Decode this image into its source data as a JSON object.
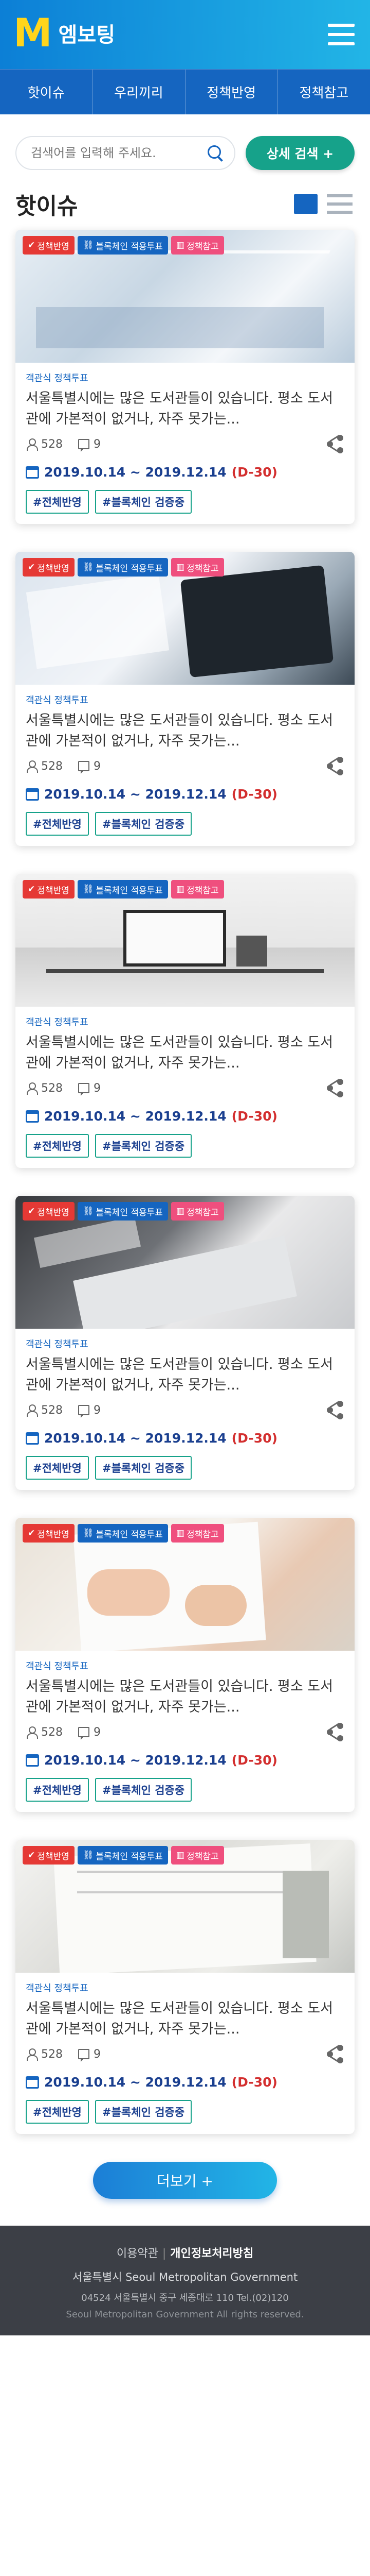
{
  "header": {
    "logo_mark": "M",
    "logo_text": "엠보팅"
  },
  "nav": [
    "핫이슈",
    "우리끼리",
    "정책반영",
    "정책참고"
  ],
  "search": {
    "placeholder": "검색어를 입력해 주세요.",
    "detail_label": "상세 검색 +"
  },
  "section": {
    "title": "핫이슈"
  },
  "cards": [
    {
      "badges": [
        "정책반영",
        "블록체인 적용투표",
        "정책참고"
      ],
      "category": "객관식  정책투표",
      "text": "서울특별시에는 많은 도서관들이 있습니다. 평소 도서관에 가본적이 없거나, 자주 못가는...",
      "views": "528",
      "comments": "9",
      "date": "2019.10.14 ~ 2019.12.14",
      "dday": "(D-30)",
      "tags": [
        "#전체반영",
        "#블록체인 검증중"
      ]
    },
    {
      "badges": [
        "정책반영",
        "블록체인 적용투표",
        "정책참고"
      ],
      "category": "객관식  정책투표",
      "text": "서울특별시에는 많은 도서관들이 있습니다. 평소 도서관에 가본적이 없거나, 자주 못가는...",
      "views": "528",
      "comments": "9",
      "date": "2019.10.14 ~ 2019.12.14",
      "dday": "(D-30)",
      "tags": [
        "#전체반영",
        "#블록체인 검증중"
      ]
    },
    {
      "badges": [
        "정책반영",
        "블록체인 적용투표",
        "정책참고"
      ],
      "category": "객관식  정책투표",
      "text": "서울특별시에는 많은 도서관들이 있습니다. 평소 도서관에 가본적이 없거나, 자주 못가는...",
      "views": "528",
      "comments": "9",
      "date": "2019.10.14 ~ 2019.12.14",
      "dday": "(D-30)",
      "tags": [
        "#전체반영",
        "#블록체인 검증중"
      ]
    },
    {
      "badges": [
        "정책반영",
        "블록체인 적용투표",
        "정책참고"
      ],
      "category": "객관식  정책투표",
      "text": "서울특별시에는 많은 도서관들이 있습니다. 평소 도서관에 가본적이 없거나, 자주 못가는...",
      "views": "528",
      "comments": "9",
      "date": "2019.10.14 ~ 2019.12.14",
      "dday": "(D-30)",
      "tags": [
        "#전체반영",
        "#블록체인 검증중"
      ]
    },
    {
      "badges": [
        "정책반영",
        "블록체인 적용투표",
        "정책참고"
      ],
      "category": "객관식  정책투표",
      "text": "서울특별시에는 많은 도서관들이 있습니다. 평소 도서관에 가본적이 없거나, 자주 못가는...",
      "views": "528",
      "comments": "9",
      "date": "2019.10.14 ~ 2019.12.14",
      "dday": "(D-30)",
      "tags": [
        "#전체반영",
        "#블록체인 검증중"
      ]
    },
    {
      "badges": [
        "정책반영",
        "블록체인 적용투표",
        "정책참고"
      ],
      "category": "객관식  정책투표",
      "text": "서울특별시에는 많은 도서관들이 있습니다. 평소 도서관에 가본적이 없거나, 자주 못가는...",
      "views": "528",
      "comments": "9",
      "date": "2019.10.14 ~ 2019.12.14",
      "dday": "(D-30)",
      "tags": [
        "#전체반영",
        "#블록체인 검증중"
      ]
    }
  ],
  "more": {
    "label": "더보기 +"
  },
  "footer": {
    "terms": "이용약관",
    "privacy": "개인정보처리방침",
    "org": "서울특별시 Seoul Metropolitan Government",
    "address": "04524 서울특별시 중구 세종대로 110   Tel.(02)120",
    "copyright": "Seoul Metropolitan Government All rights reserved."
  },
  "colors": {
    "brand": "#1565c0",
    "accent": "#16a28a",
    "logo": "#ffd51c",
    "dday": "#d32f2f"
  },
  "icons": [
    "menu-icon",
    "search-icon",
    "card-view-icon",
    "list-view-icon",
    "check-icon",
    "link-icon",
    "book-icon",
    "person-icon",
    "comment-icon",
    "share-icon",
    "calendar-icon"
  ]
}
